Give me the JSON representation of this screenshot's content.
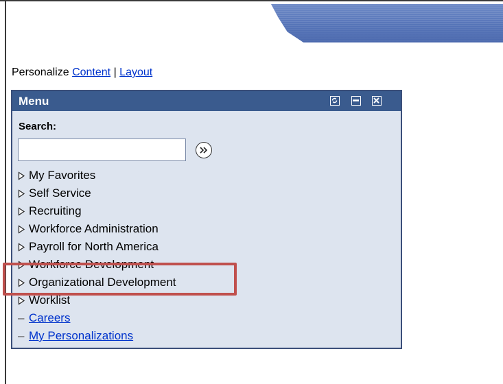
{
  "personalize": {
    "prefix": "Personalize",
    "content_link": "Content",
    "separator": "|",
    "layout_link": "Layout"
  },
  "menu": {
    "title": "Menu",
    "header_icons": [
      "refresh-icon",
      "minimize-icon",
      "close-icon"
    ],
    "search_label": "Search:",
    "search_value": "",
    "search_go_icon": "double-chevron-right-icon",
    "items": [
      {
        "label": "My Favorites",
        "type": "folder"
      },
      {
        "label": "Self Service",
        "type": "folder"
      },
      {
        "label": "Recruiting",
        "type": "folder"
      },
      {
        "label": "Workforce Administration",
        "type": "folder"
      },
      {
        "label": "Payroll for North America",
        "type": "folder"
      },
      {
        "label": "Workforce Development",
        "type": "folder"
      },
      {
        "label": "Organizational Development",
        "type": "folder",
        "highlighted": true
      },
      {
        "label": "Worklist",
        "type": "folder"
      },
      {
        "label": "Careers",
        "type": "link"
      },
      {
        "label": "My Personalizations",
        "type": "link"
      }
    ]
  },
  "colors": {
    "menu_header_bg": "#3a5b8e",
    "menu_body_bg": "#dde4ef",
    "link": "#0033cc",
    "highlight_border": "#c0504d",
    "banner": "#5674b8"
  }
}
